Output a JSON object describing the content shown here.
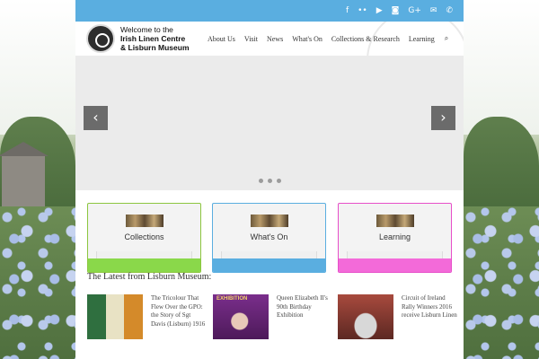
{
  "topbar": {
    "social_icons": [
      "facebook-icon",
      "flickr-icon",
      "youtube-icon",
      "instagram-icon",
      "google-plus-icon",
      "email-icon",
      "phone-icon"
    ],
    "glyphs": [
      "f",
      "••",
      "▶",
      "◙",
      "G+",
      "✉",
      "✆"
    ],
    "color": "#5aaee0"
  },
  "header": {
    "logo_line1": "Welcome to the",
    "logo_line2": "Irish Linen Centre",
    "logo_line3": "& Lisburn Museum",
    "nav": [
      "About Us",
      "Visit",
      "News",
      "What's On",
      "Collections & Research",
      "Learning"
    ],
    "search_glyph": "🔍"
  },
  "slider": {
    "prev_glyph": "‹",
    "next_glyph": "›",
    "slide_count": 3
  },
  "cards": [
    {
      "title": "Collections",
      "color": "#8ad84a"
    },
    {
      "title": "What's On",
      "color": "#5aaee0"
    },
    {
      "title": "Learning",
      "color": "#f36ad9"
    }
  ],
  "latest": {
    "heading": "The Latest from Lisburn Museum:",
    "items": [
      {
        "title": "The Tricolour That Flew Over the GPO: the Story of Sgt Davis (Lisburn) 1916"
      },
      {
        "title": "Queen Elizabeth II's 90th Birthday Exhibition",
        "image_text": "EXHIBITION"
      },
      {
        "title": "Circuit of Ireland Rally Winners 2016 receive Lisburn Linen"
      }
    ]
  }
}
